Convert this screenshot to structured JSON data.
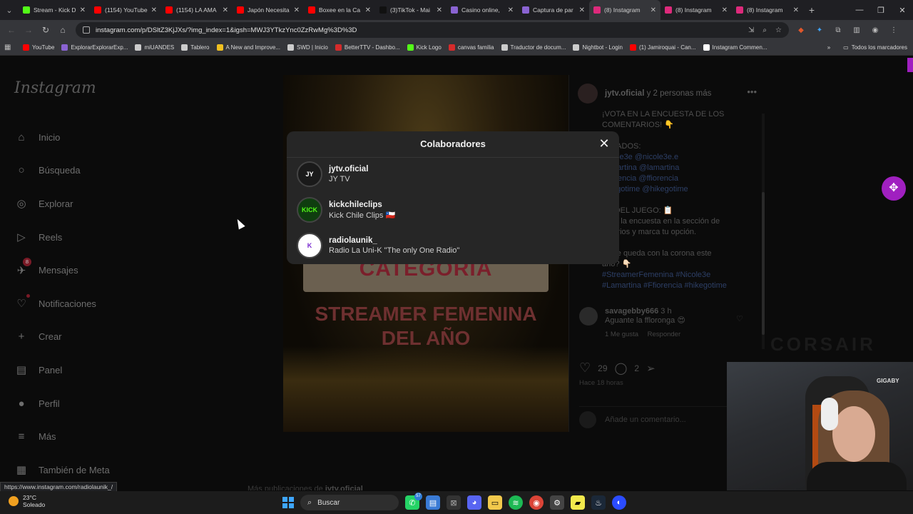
{
  "browser": {
    "tabs": [
      {
        "label": "Stream - Kick D",
        "color": "#53fc18",
        "active": false
      },
      {
        "label": "(1154) YouTube",
        "color": "#ff0000",
        "active": false
      },
      {
        "label": "(1154) LA AMA",
        "color": "#ff0000",
        "active": false
      },
      {
        "label": "Japón Necesita",
        "color": "#ff0000",
        "active": false
      },
      {
        "label": "Boxee en la Ca",
        "color": "#ff0000",
        "active": false
      },
      {
        "label": "(3)TikTok - Mai",
        "color": "#111111",
        "active": false
      },
      {
        "label": "Casino online,",
        "color": "#8a63d2",
        "active": false
      },
      {
        "label": "Captura de par",
        "color": "#8a63d2",
        "active": false
      },
      {
        "label": "(8) Instagram",
        "color": "#dd2a7b",
        "active": true
      },
      {
        "label": "(8) Instagram",
        "color": "#dd2a7b",
        "active": false
      },
      {
        "label": "(8) Instagram",
        "color": "#dd2a7b",
        "active": false
      }
    ],
    "url": "instagram.com/p/DSltZ3KjJXs/?img_index=1&igsh=MWJ3YTkzYnc0ZzRwMg%3D%3D",
    "bookmarks": [
      {
        "label": "YouTube",
        "color": "#ff0000"
      },
      {
        "label": "ExplorarExplorarExp...",
        "color": "#8a63d2"
      },
      {
        "label": "miUANDES",
        "color": "#cccccc"
      },
      {
        "label": "Tablero",
        "color": "#cccccc"
      },
      {
        "label": "A New and Improve...",
        "color": "#f0c020"
      },
      {
        "label": "SWD | Inicio",
        "color": "#cccccc"
      },
      {
        "label": "BetterTTV - Dashbo...",
        "color": "#d52b2b"
      },
      {
        "label": "Kick Logo",
        "color": "#53fc18"
      },
      {
        "label": "canvas familia",
        "color": "#d52b2b"
      },
      {
        "label": "Traductor de docum...",
        "color": "#cccccc"
      },
      {
        "label": "Nightbot - Login",
        "color": "#cccccc"
      },
      {
        "label": "(1) Jamiroquai - Can...",
        "color": "#ff0000"
      },
      {
        "label": "Instagram Commen...",
        "color": "#ffffff"
      }
    ],
    "bookmarks_folder": "Todos los marcadores",
    "status_url": "https://www.instagram.com/radiolaunik_/"
  },
  "sidebar": {
    "logo": "Instagram",
    "items": [
      {
        "label": "Inicio",
        "icon": "home-icon",
        "glyph": "⌂"
      },
      {
        "label": "Búsqueda",
        "icon": "search-icon",
        "glyph": "○"
      },
      {
        "label": "Explorar",
        "icon": "compass-icon",
        "glyph": "◎"
      },
      {
        "label": "Reels",
        "icon": "reels-icon",
        "glyph": "▷"
      },
      {
        "label": "Mensajes",
        "icon": "messenger-icon",
        "glyph": "✈",
        "badge": "8"
      },
      {
        "label": "Notificaciones",
        "icon": "heart-icon",
        "glyph": "♡",
        "dot": true
      },
      {
        "label": "Crear",
        "icon": "plus-icon",
        "glyph": "+"
      },
      {
        "label": "Panel",
        "icon": "chart-icon",
        "glyph": "▤"
      },
      {
        "label": "Perfil",
        "icon": "avatar-icon",
        "glyph": "●"
      },
      {
        "label": "Más",
        "icon": "menu-icon",
        "glyph": "≡"
      },
      {
        "label": "También de Meta",
        "icon": "meta-icon",
        "glyph": "▦"
      }
    ]
  },
  "post": {
    "image_text_top": "CATEGORÍA",
    "image_text_bottom": "STREAMER FEMENINA DEL AÑO",
    "author": "jytv.oficial",
    "author_suffix": "y 2 personas más",
    "caption_lines": [
      "¡VOTA EN LA ENCUESTA DE LOS",
      "COMENTARIOS! 👇",
      "",
      "MINADOS:",
      "Nicole3e @nicole3e.e",
      "Lamartina @lamartina",
      "Ffiorencia @ffiorencia",
      "hikegotime @hikegotime",
      "",
      "AS DEL JUEGO: 📋",
      "usca la encuesta en la sección de",
      "entarios y marca tu opción.",
      "",
      "én se queda con la corona este",
      "año? 👇🏻",
      "#StreamerFemenina #Nicole3e",
      "#Lamartina #Ffiorencia #hikegotime"
    ],
    "comment_user": "savagebby666",
    "comment_time": "3 h",
    "comment_text": "Aguante la ffloronga 😍",
    "comment_likes": "1 Me gusta",
    "comment_reply": "Responder",
    "likes_count": "29",
    "comments_count": "2",
    "posted": "Hace 18 horas",
    "add_comment_placeholder": "Añade un comentario...",
    "more_from_prefix": "Más publicaciones de",
    "more_from_user": "jytv.oficial"
  },
  "modal": {
    "title": "Colaboradores",
    "collaborators": [
      {
        "username": "jytv.oficial",
        "name": "JY TV",
        "avatar_text": "JY",
        "avatar_bg": "#1a1a1a",
        "avatar_fg": "#ffffff"
      },
      {
        "username": "kickchileclips",
        "name": "Kick Chile Clips 🇨🇱",
        "avatar_text": "KICK",
        "avatar_bg": "#0f3d0f",
        "avatar_fg": "#53fc18"
      },
      {
        "username": "radiolaunik_",
        "name": "Radio La Uni-K \"The only One Radio\"",
        "avatar_text": "K",
        "avatar_bg": "#ffffff",
        "avatar_fg": "#7a2bd0"
      }
    ]
  },
  "overlay": {
    "corsair": "CORSAIR",
    "chair_brand": "GIGABY"
  },
  "taskbar": {
    "temp": "23°C",
    "weather": "Soleado",
    "search_placeholder": "Buscar",
    "whatsapp_badge": "57"
  }
}
